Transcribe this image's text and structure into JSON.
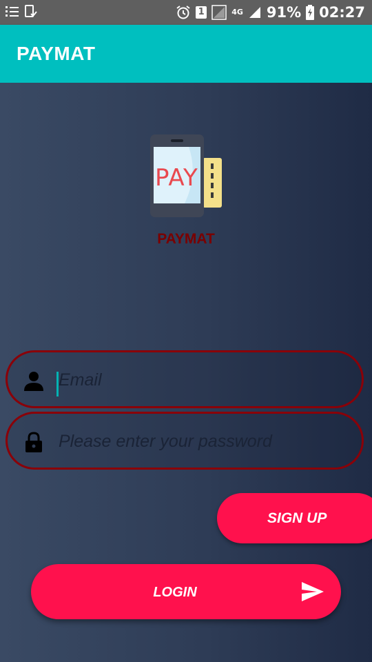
{
  "status_bar": {
    "sim_badge": "1",
    "network_type": "4G",
    "battery_percent": "91%",
    "time": "02:27",
    "icons": [
      "list-icon",
      "cast-icon",
      "alarm-icon",
      "sim-icon",
      "signal-icon",
      "battery-charging-icon"
    ]
  },
  "app_bar": {
    "title": "PAYMAT"
  },
  "logo": {
    "text": "PAY",
    "caption": "PAYMAT",
    "icon": "phone-pay-icon"
  },
  "form": {
    "email": {
      "value": "",
      "placeholder": "Email",
      "icon": "person-icon"
    },
    "password": {
      "value": "",
      "placeholder": "Please enter your password",
      "icon": "lock-icon"
    }
  },
  "buttons": {
    "signup_label": "SIGN UP",
    "login_label": "LOGIN",
    "login_icon": "send-icon"
  },
  "colors": {
    "status_bar": "#5f5f5f",
    "app_bar": "#00bfbf",
    "accent_button": "#ff114d",
    "field_border": "#8a0008",
    "caption": "#7a0000",
    "background": "#2f3b52"
  }
}
